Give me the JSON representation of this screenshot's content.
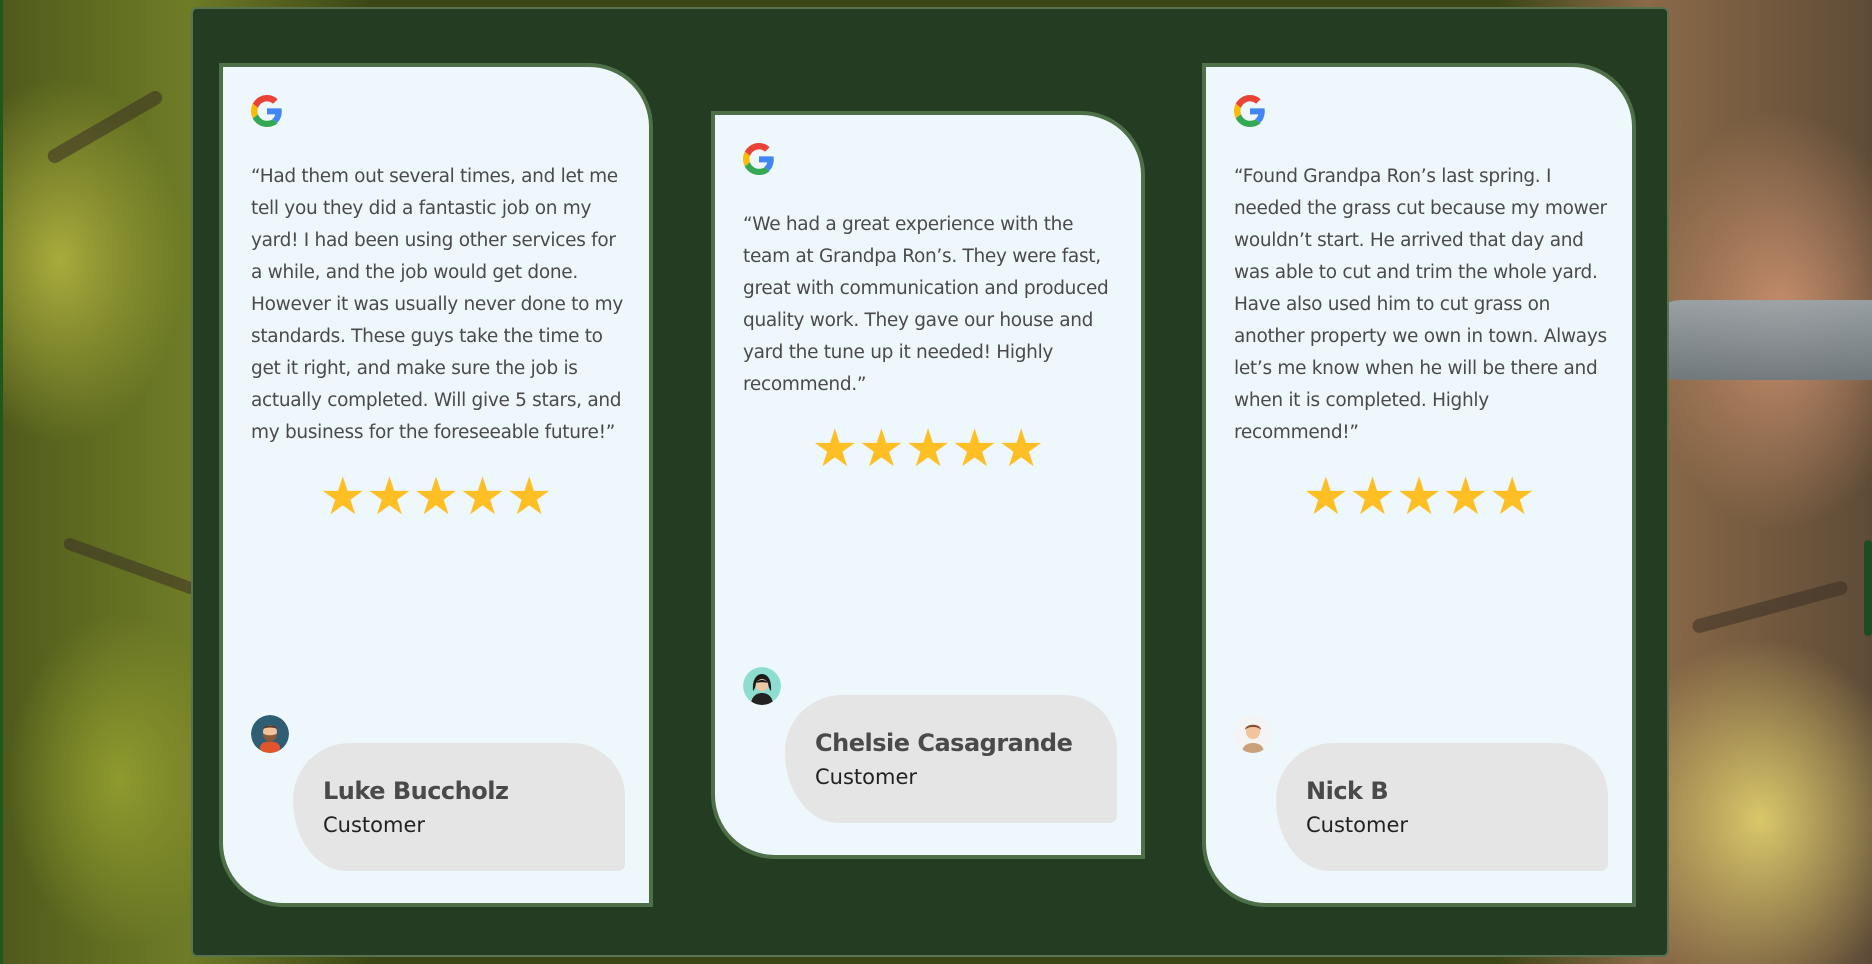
{
  "reviews": [
    {
      "source_icon": "google-icon",
      "quote": "“Had them out several times, and let me tell you they did a fantastic job on my yard! I had been using other services for a while, and the job would get done. However it was usually never done to my standards. These guys take the time to get it right, and make sure the job is actually completed. Will give 5 stars, and my business for the foreseeable future!”",
      "rating": 5,
      "stars": "★★★★★",
      "name": "Luke Buccholz",
      "role": "Customer",
      "avatar_icon": "bearded-man-avatar-icon"
    },
    {
      "source_icon": "google-icon",
      "quote": "“We had a great experience with the team at Grandpa Ron’s. They were fast, great with communication and produced quality work. They gave our house and yard the tune up it needed! Highly recommend.”",
      "rating": 5,
      "stars": "★★★★★",
      "name": "Chelsie Casagrande",
      "role": "Customer",
      "avatar_icon": "woman-avatar-icon"
    },
    {
      "source_icon": "google-icon",
      "quote": "“Found Grandpa Ron’s last spring. I needed the grass cut because my mower wouldn’t start. He arrived that day and was able to cut and trim the whole yard. Have also used him to cut grass on another property we own in town. Always let’s me know when he will be there and when it is completed. Highly recommend!”",
      "rating": 5,
      "stars": "★★★★★",
      "name": "Nick B",
      "role": "Customer",
      "avatar_icon": "man-avatar-icon"
    }
  ],
  "colors": {
    "panel": "#243c22",
    "card": "#eef7fc",
    "card_border": "#4d7049",
    "star": "#fdbf24",
    "name_bubble": "#e5e5e5"
  }
}
